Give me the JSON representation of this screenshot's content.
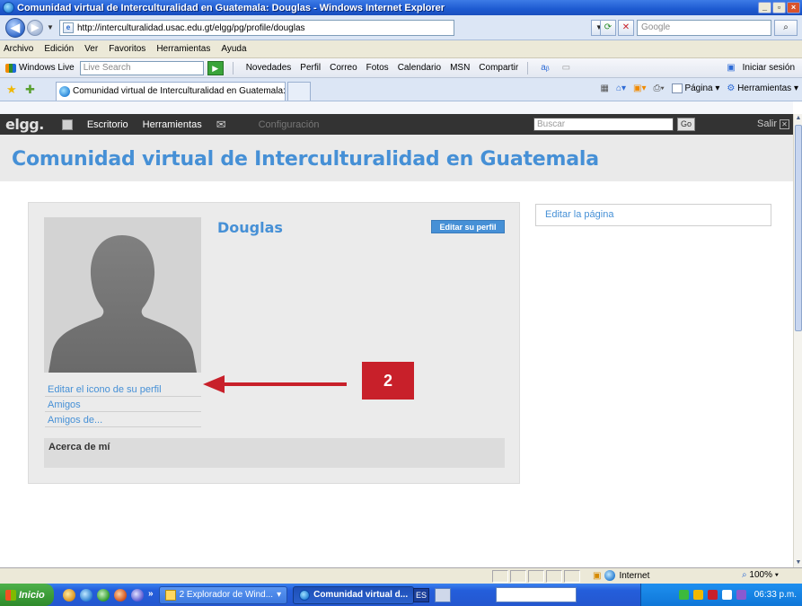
{
  "window": {
    "title": "Comunidad virtual de Interculturalidad en Guatemala: Douglas - Windows Internet Explorer",
    "controls": [
      "_",
      "▫",
      "×"
    ]
  },
  "address_bar": {
    "url": "http://interculturalidad.usac.edu.gt/elgg/pg/profile/douglas",
    "search_placeholder": "Google"
  },
  "menu_bar": {
    "items": [
      "Archivo",
      "Edición",
      "Ver",
      "Favoritos",
      "Herramientas",
      "Ayuda"
    ]
  },
  "live_toolbar": {
    "brand": "Windows Live",
    "search_placeholder": "Live Search",
    "links": [
      "Novedades",
      "Perfil",
      "Correo",
      "Fotos",
      "Calendario",
      "MSN",
      "Compartir"
    ],
    "signin": "Iniciar sesión"
  },
  "tab_bar": {
    "tab_title": "Comunidad virtual de Interculturalidad en Guatemala: ...",
    "page_menu": "Página",
    "tools_menu": "Herramientas"
  },
  "elgg_topbar": {
    "logo": "elgg.",
    "nav": [
      "Escritorio",
      "Herramientas"
    ],
    "settings": "Configuración",
    "search_placeholder": "Buscar",
    "go": "Go",
    "logout": "Salir"
  },
  "site": {
    "name": "Comunidad virtual de Interculturalidad en Guatemala"
  },
  "profile": {
    "username": "Douglas",
    "edit_profile_button": "Editar su perfil",
    "menu": [
      "Editar el icono de su perfil",
      "Amigos",
      "Amigos de..."
    ],
    "about_heading": "Acerca de mí"
  },
  "sidebar": {
    "edit_page": "Editar la página"
  },
  "callout": {
    "number": "2",
    "color": "#c8202a"
  },
  "status_bar": {
    "zone": "Internet",
    "zoom": "100%"
  },
  "taskbar": {
    "start": "Inicio",
    "tasks": [
      "2 Explorador de Wind...",
      "Comunidad virtual d..."
    ],
    "lang": "ES",
    "clock": "06:33 p.m."
  },
  "colors": {
    "elgg_blue": "#4690d6",
    "elgg_bar": "#333333",
    "xp_blue": "#245edb"
  }
}
